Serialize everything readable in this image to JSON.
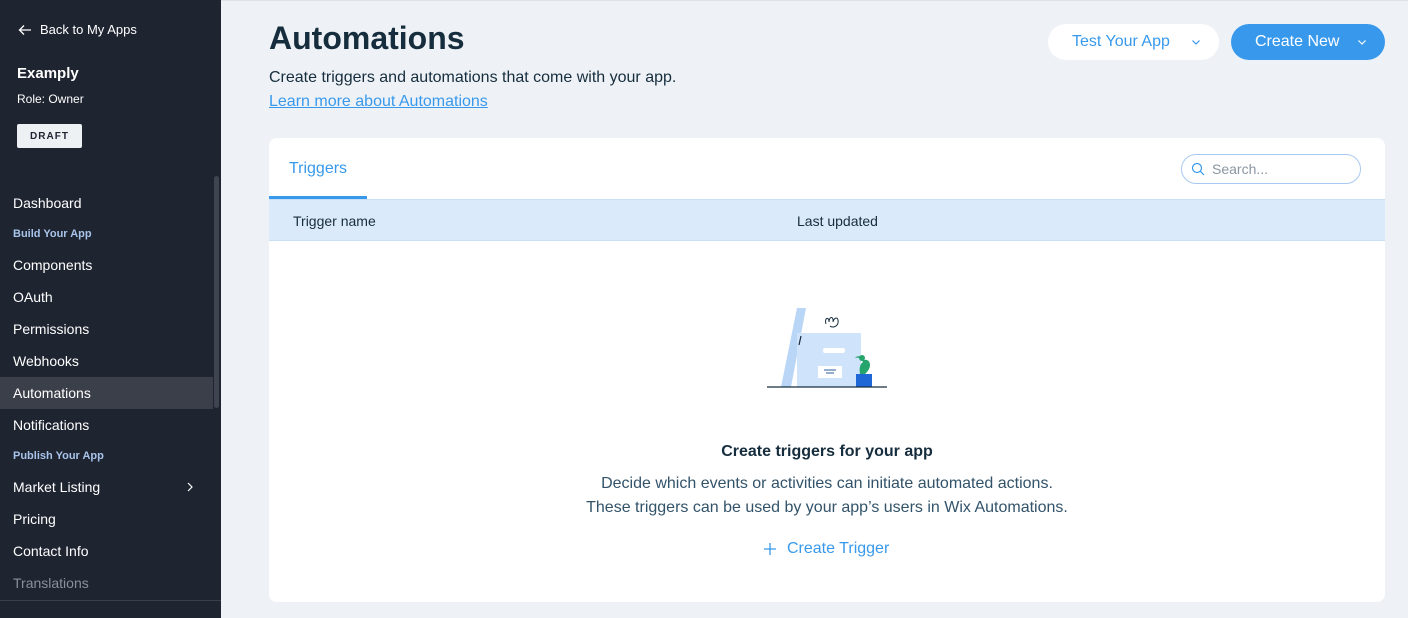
{
  "sidebar": {
    "back_label": "Back to My Apps",
    "app_name": "Examply",
    "role": "Role: Owner",
    "status_badge": "DRAFT",
    "items": [
      {
        "label": "Dashboard"
      },
      {
        "section": "Build Your App"
      },
      {
        "label": "Components"
      },
      {
        "label": "OAuth"
      },
      {
        "label": "Permissions"
      },
      {
        "label": "Webhooks"
      },
      {
        "label": "Automations",
        "active": true
      },
      {
        "label": "Notifications"
      },
      {
        "section": "Publish Your App"
      },
      {
        "label": "Market Listing",
        "has_chevron": true
      },
      {
        "label": "Pricing"
      },
      {
        "label": "Contact Info"
      },
      {
        "label": "Translations"
      }
    ]
  },
  "header": {
    "title": "Automations",
    "subtitle": "Create triggers and automations that come with your app.",
    "learn_more": "Learn more about Automations",
    "test_button": "Test Your App",
    "create_button": "Create New"
  },
  "card": {
    "tab_label": "Triggers",
    "search_placeholder": "Search...",
    "columns": [
      "Trigger name",
      "Last updated"
    ],
    "empty_title": "Create triggers for your app",
    "empty_desc_line1": "Decide which events or activities can initiate automated actions.",
    "empty_desc_line2": "These triggers can be used by your app’s users in Wix Automations.",
    "create_trigger": "Create Trigger"
  },
  "colors": {
    "sidebar_bg": "#1f2431",
    "accent": "#3899ec",
    "page_bg": "#eef2f6",
    "table_header_bg": "#daeafb"
  }
}
